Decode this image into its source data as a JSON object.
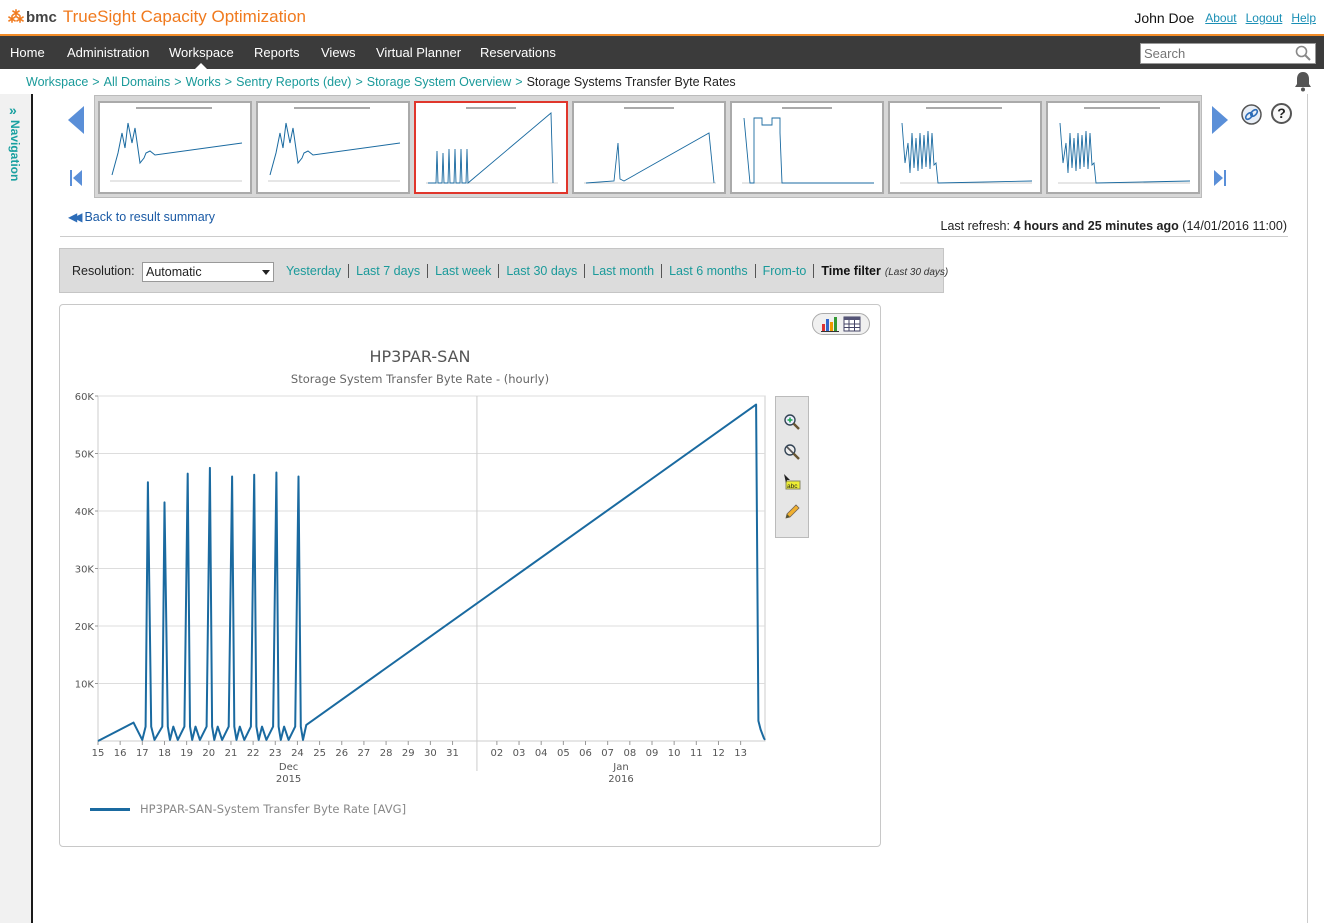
{
  "brand": {
    "mark": "⁂",
    "company": "bmc",
    "product": "TrueSight Capacity Optimization"
  },
  "user": {
    "name": "John Doe",
    "about": "About",
    "logout": "Logout",
    "help": "Help"
  },
  "menu": [
    "Home",
    "Administration",
    "Workspace",
    "Reports",
    "Views",
    "Virtual Planner",
    "Reservations"
  ],
  "search": {
    "placeholder": "Search"
  },
  "breadcrumb": [
    "Workspace",
    "All Domains",
    "Works",
    "Sentry Reports (dev)",
    "Storage System Overview"
  ],
  "breadcrumb_current": "Storage Systems Transfer Byte Rates",
  "nav": {
    "label": "Navigation",
    "toggle": "»"
  },
  "help_glyph": "?",
  "back_link": "Back to result summary",
  "back_glyph": "◀◀",
  "last_refresh": {
    "label": "Last refresh:",
    "value": "4 hours and 25 minutes ago",
    "date": "(14/01/2016 11:00)"
  },
  "filter": {
    "resolution_label": "Resolution:",
    "resolution_value": "Automatic",
    "links": [
      "Yesterday",
      "Last 7 days",
      "Last week",
      "Last 30 days",
      "Last month",
      "Last 6 months",
      "From-to"
    ],
    "time_filter": "Time filter",
    "time_filter_sub": "(Last 30 days)"
  },
  "thumbnails": {
    "count": 7,
    "selected_index": 2
  },
  "chart_data": {
    "type": "line",
    "title": "HP3PAR-SAN",
    "subtitle": "Storage System Transfer Byte Rate - (hourly)",
    "ylim": [
      0,
      60000
    ],
    "yticks": [
      "10K",
      "20K",
      "30K",
      "40K",
      "50K",
      "60K"
    ],
    "ytick_values": [
      10000,
      20000,
      30000,
      40000,
      50000,
      60000
    ],
    "xtick_labels": [
      "15",
      "16",
      "17",
      "18",
      "19",
      "20",
      "21",
      "22",
      "23",
      "24",
      "25",
      "26",
      "27",
      "28",
      "29",
      "30",
      "31",
      "02",
      "03",
      "04",
      "05",
      "06",
      "07",
      "08",
      "09",
      "10",
      "11",
      "12",
      "13"
    ],
    "xtick_days": [
      0,
      1,
      2,
      3,
      4,
      5,
      6,
      7,
      8,
      9,
      10,
      11,
      12,
      13,
      14,
      15,
      16,
      18,
      19,
      20,
      21,
      22,
      23,
      24,
      25,
      26,
      27,
      28,
      29
    ],
    "xlim_days": [
      0,
      30.1
    ],
    "x_origin_note": "",
    "month_labels": [
      {
        "month": "Dec",
        "year": "2015",
        "day": 8.6
      },
      {
        "month": "Jan",
        "year": "2016",
        "day": 23.6
      }
    ],
    "month_divider_day": 17.1,
    "grid": true,
    "series": [
      {
        "name": "HP3PAR-SAN-System Transfer Byte Rate [AVG]",
        "color": "#1a6aa0",
        "x_days": [
          0,
          1.6,
          2.0,
          2.15,
          2.25,
          2.4,
          2.55,
          2.9,
          3.0,
          3.15,
          3.25,
          3.4,
          3.6,
          3.9,
          4.05,
          4.15,
          4.25,
          4.4,
          4.6,
          4.9,
          5.05,
          5.15,
          5.25,
          5.4,
          5.6,
          5.9,
          6.05,
          6.15,
          6.25,
          6.4,
          6.6,
          6.9,
          7.05,
          7.15,
          7.25,
          7.4,
          7.6,
          7.9,
          8.05,
          8.15,
          8.25,
          8.4,
          8.6,
          8.9,
          9.05,
          9.15,
          9.25,
          9.4,
          29.7,
          29.8,
          29.9,
          30.05,
          30.1
        ],
        "y": [
          0,
          3200,
          200,
          2500,
          45000,
          2500,
          200,
          2500,
          41500,
          2500,
          200,
          2500,
          200,
          2500,
          46500,
          2500,
          200,
          2500,
          200,
          2500,
          47500,
          2500,
          200,
          2500,
          200,
          2500,
          46000,
          2500,
          200,
          2500,
          200,
          2500,
          46300,
          2500,
          200,
          2500,
          200,
          2500,
          46700,
          2500,
          200,
          2500,
          200,
          2500,
          46000,
          2500,
          200,
          2800,
          58500,
          3500,
          2000,
          500,
          200
        ]
      }
    ]
  },
  "legend": {
    "label": "HP3PAR-SAN-System Transfer Byte Rate [AVG]"
  }
}
